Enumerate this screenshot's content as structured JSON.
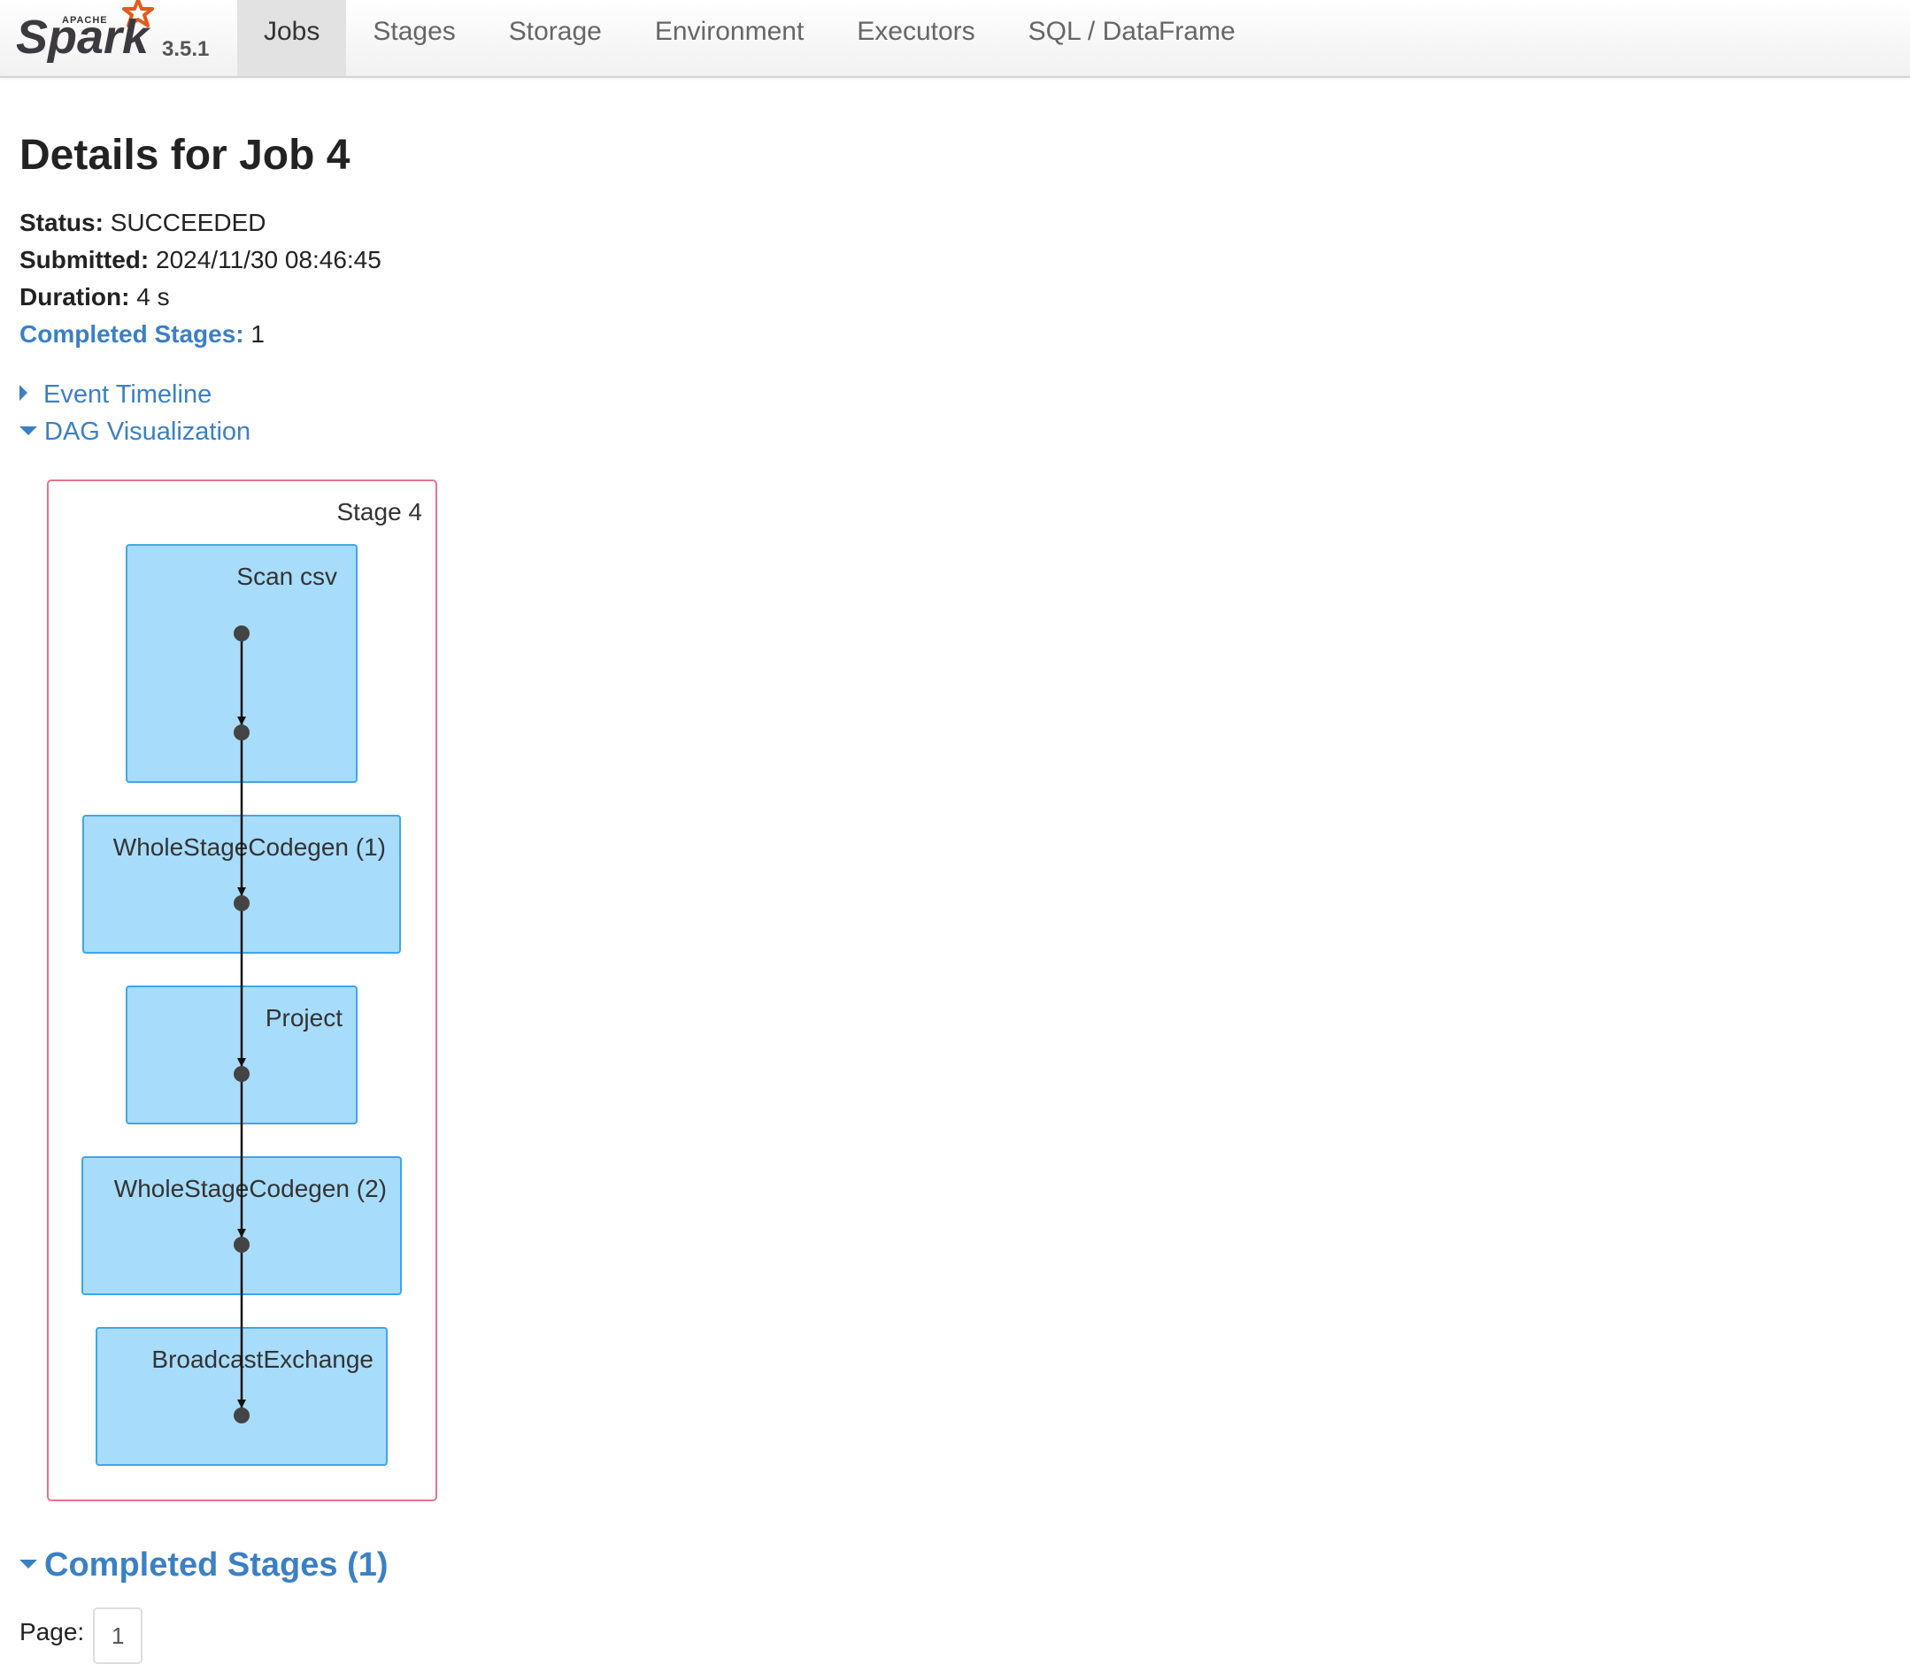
{
  "brand": {
    "logo_small_text": "APACHE",
    "logo_text": "Spark",
    "version": "3.5.1"
  },
  "nav": {
    "tabs": [
      {
        "label": "Jobs",
        "active": true
      },
      {
        "label": "Stages",
        "active": false
      },
      {
        "label": "Storage",
        "active": false
      },
      {
        "label": "Environment",
        "active": false
      },
      {
        "label": "Executors",
        "active": false
      },
      {
        "label": "SQL / DataFrame",
        "active": false
      }
    ]
  },
  "page": {
    "title": "Details for Job 4"
  },
  "summary": {
    "status_label": "Status:",
    "status_value": "SUCCEEDED",
    "submitted_label": "Submitted:",
    "submitted_value": "2024/11/30 08:46:45",
    "duration_label": "Duration:",
    "duration_value": "4 s",
    "completed_stages_label": "Completed Stages:",
    "completed_stages_value": "1"
  },
  "toggles": {
    "event_timeline": "Event Timeline",
    "dag_visualization": "DAG Visualization"
  },
  "dag": {
    "stage_label": "Stage 4",
    "nodes": [
      {
        "label": "Scan csv"
      },
      {
        "label": "WholeStageCodegen (1)"
      },
      {
        "label": "Project"
      },
      {
        "label": "WholeStageCodegen (2)"
      },
      {
        "label": "BroadcastExchange"
      }
    ],
    "colors": {
      "stage_border": "#e8738a",
      "node_fill": "#a8dcfb",
      "node_border": "#3ea6ea",
      "point": "#444444",
      "edge": "#111111"
    }
  },
  "completed_stages": {
    "title": "Completed Stages (1)",
    "page_label": "Page:",
    "current_page": "1"
  }
}
